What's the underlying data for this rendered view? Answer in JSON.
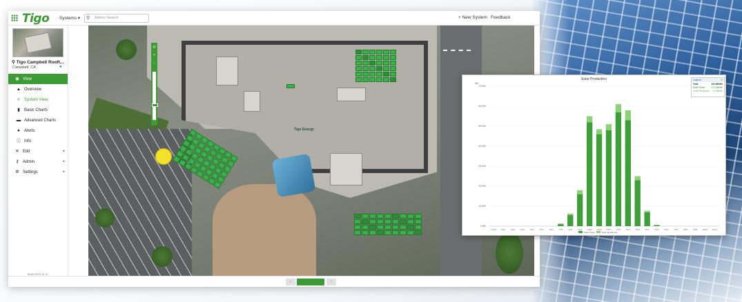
{
  "header": {
    "logo": "Tigo",
    "systems_menu": "Systems ▾",
    "search_placeholder": "Admin Search",
    "new_system": "+ New System",
    "feedback": "Feedback"
  },
  "site": {
    "name": "Tigo Campbell Rooft...",
    "location": "Campbell, CA"
  },
  "nav": {
    "view": {
      "label": "View",
      "icon": "eye-icon"
    },
    "overview": {
      "label": "Overview",
      "icon": "overview-icon"
    },
    "system_view": {
      "label": "System View",
      "icon": "grid-icon"
    },
    "basic_charts": {
      "label": "Basic Charts",
      "icon": "bar-chart-icon"
    },
    "advanced_charts": {
      "label": "Advanced Charts",
      "icon": "advanced-chart-icon"
    },
    "alerts": {
      "label": "Alerts",
      "icon": "alert-icon"
    },
    "info": {
      "label": "Info",
      "icon": "info-icon"
    },
    "edit": {
      "label": "Edit",
      "icon": "tools-icon"
    },
    "admin": {
      "label": "Admin",
      "icon": "key-icon"
    },
    "settings": {
      "label": "Settings",
      "icon": "gear-icon"
    }
  },
  "footer": {
    "build": "Build 2023.11.11",
    "collapse": "«"
  },
  "map": {
    "building_label": "Tigo Energy",
    "marker_color": "#f3e12a",
    "panel_color": "#3bb14a"
  },
  "pager": {
    "prev": "‹",
    "next": "›"
  },
  "chart_data": {
    "type": "bar",
    "title": "Solar Production",
    "y_unit": "Wh",
    "categories": [
      "12AM",
      "1AM",
      "2AM",
      "3AM",
      "4AM",
      "5AM",
      "6AM",
      "7AM",
      "8AM",
      "9AM",
      "10AM",
      "11AM",
      "12PM",
      "1PM",
      "2PM",
      "3PM",
      "4PM",
      "5PM",
      "6PM",
      "7PM",
      "8PM",
      "9PM",
      "10PM",
      "11PM"
    ],
    "series": [
      {
        "name": "Solar Power",
        "color": "#3e9e3a",
        "values": [
          0,
          0,
          0,
          0,
          0,
          0,
          0,
          1000,
          5500,
          16000,
          52000,
          46000,
          48000,
          57000,
          53000,
          23000,
          7000,
          500,
          0,
          0,
          0,
          0,
          0,
          0
        ]
      },
      {
        "name": "Solar Reclaimed",
        "color": "#8fd07a",
        "values": [
          0,
          0,
          0,
          0,
          0,
          0,
          0,
          300,
          800,
          2000,
          3000,
          2500,
          3000,
          4000,
          5000,
          2000,
          700,
          100,
          0,
          0,
          0,
          0,
          0,
          0
        ]
      }
    ],
    "y_ticks": [
      "0 Wh",
      "10,000",
      "20,000",
      "30,000",
      "40,000",
      "50,000",
      "60,000",
      "70,000"
    ],
    "ylim": [
      0,
      70000
    ],
    "legend": {
      "title": "Legend",
      "rows": [
        {
          "label": "Total",
          "value": "100.85kWh"
        },
        {
          "label": "Solar Power",
          "value": "172.55kWh"
        },
        {
          "label": "Solar Reclaimed",
          "value": "11.88kWh"
        }
      ]
    },
    "bottom_legend": [
      "Solar Power",
      "Solar Reclaimed"
    ]
  }
}
